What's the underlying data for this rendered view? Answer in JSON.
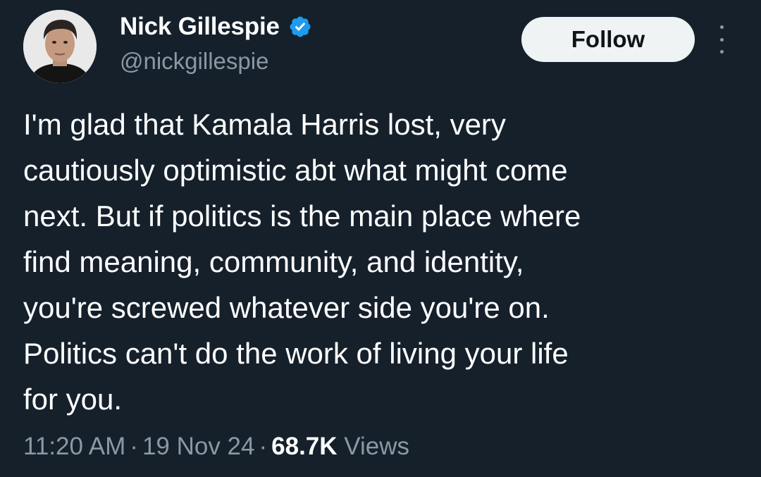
{
  "tweet": {
    "author": {
      "display_name": "Nick Gillespie",
      "handle": "@nickgillespie",
      "verified": true,
      "avatar_icon": "profile-photo"
    },
    "follow_label": "Follow",
    "more_icon": "more-vertical-icon",
    "text_lines": [
      "I'm glad that Kamala Harris lost, very",
      "cautiously optimistic abt what might come",
      "next. But if politics is the main place where",
      "find meaning, community, and identity,",
      "you're screwed whatever side you're on.",
      "Politics can't do the work of living your life",
      "for you."
    ],
    "meta": {
      "time": "11:20 AM",
      "separator": "·",
      "date": "19 Nov 24",
      "views_count": "68.7K",
      "views_label": "Views"
    }
  },
  "colors": {
    "background": "#15202b",
    "text_primary": "#ffffff",
    "text_secondary": "#8b98a5",
    "verified_blue": "#1d9bf0",
    "follow_bg": "#eff3f4",
    "follow_text": "#0f1419"
  }
}
